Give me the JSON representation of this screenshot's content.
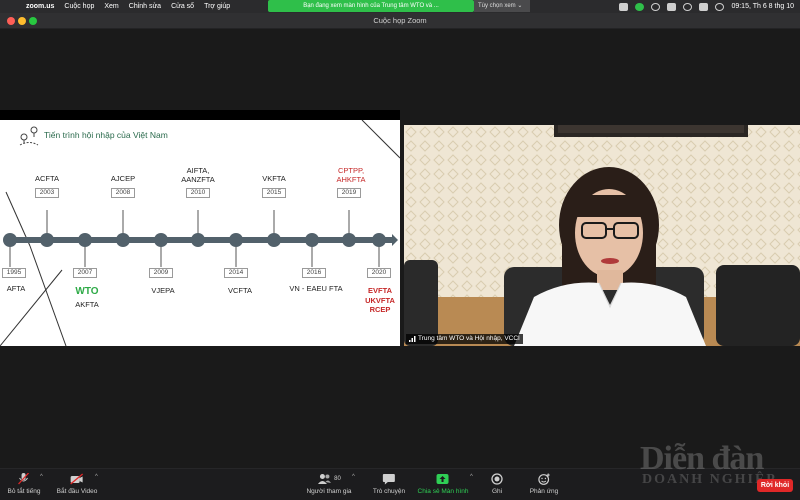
{
  "menubar": {
    "items": [
      "zoom.us",
      "Cuộc họp",
      "Xem",
      "Chỉnh sửa",
      "Cửa sổ",
      "Trợ giúp"
    ],
    "share_banner": "Bạn đang xem màn hình của Trung tâm WTO và ...",
    "view_options": "Tùy chọn xem ⌄",
    "clock": "09:15, Th 6 8 thg 10"
  },
  "window": {
    "title": "Cuộc họp Zoom"
  },
  "slide": {
    "title": "Tiến trình hội nhập của Việt Nam",
    "top_events": [
      {
        "label": "ACFTA",
        "year": "2003"
      },
      {
        "label": "AJCEP",
        "year": "2008"
      },
      {
        "label": "AIFTA,\nAANZFTA",
        "year": "2010"
      },
      {
        "label": "VKFTA",
        "year": "2015"
      },
      {
        "label": "CPTPP,\nAHKFTA",
        "year": "2019"
      }
    ],
    "bottom_events": [
      {
        "year": "1995",
        "label": "AFTA"
      },
      {
        "year": "2007",
        "label_highlight": "WTO",
        "label": "AKFTA"
      },
      {
        "year": "2009",
        "label": "VJEPA"
      },
      {
        "year": "2014",
        "label": "VCFTA"
      },
      {
        "year": "2016",
        "label": "VN - EAEU FTA"
      },
      {
        "year": "2020",
        "label": "EVFTA\nUKVFTA\nRCEP"
      }
    ]
  },
  "camera": {
    "participant_name": "Trung tâm WTO và Hội nhập, VCCI"
  },
  "toolbar": {
    "mute": "Bỏ tắt tiếng",
    "video": "Bắt đầu Video",
    "participants": "Người tham gia",
    "participant_count": "80",
    "chat": "Trò chuyện",
    "share": "Chia sẻ Màn hình",
    "record": "Ghi",
    "reactions": "Phản ứng",
    "leave": "Rời khỏi"
  },
  "watermark": {
    "line1": "Diễn đàn",
    "line2": "DOANH NGHIỆP"
  }
}
